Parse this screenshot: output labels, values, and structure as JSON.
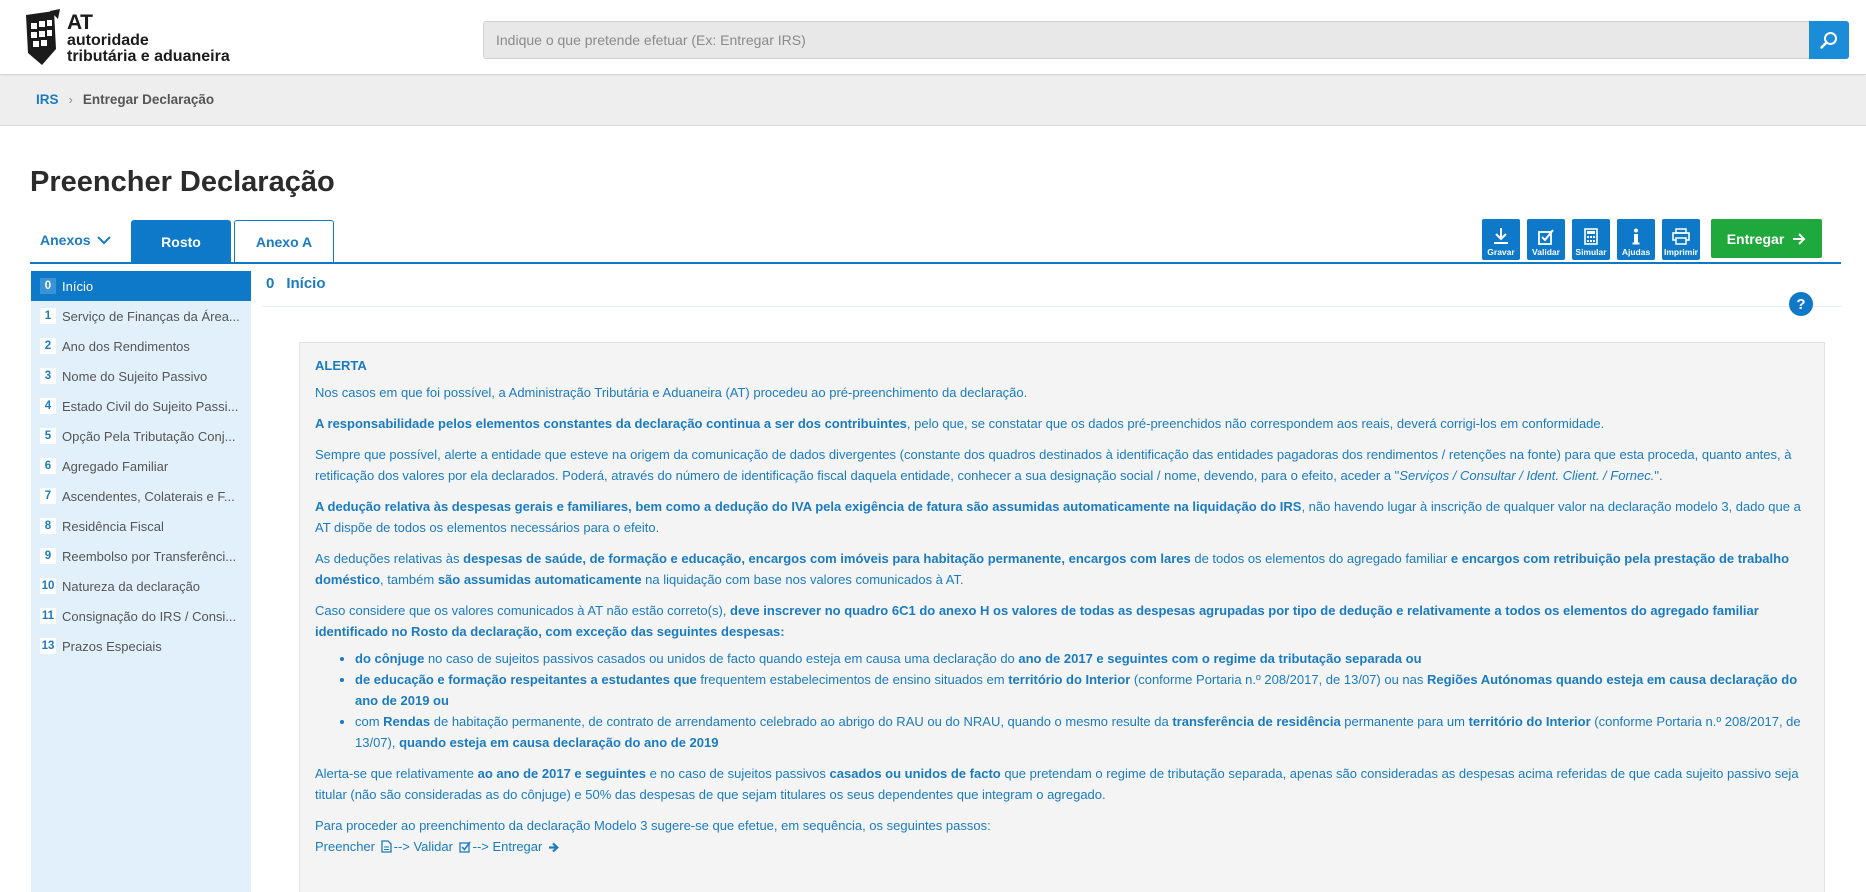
{
  "header": {
    "logo_big": "AT",
    "logo_line1": "autoridade",
    "logo_line2": "tributária e aduaneira",
    "search_placeholder": "Indique o que pretende efetuar (Ex: Entregar IRS)",
    "search_icon": "search-icon",
    "accent_color": "#0e78c9"
  },
  "breadcrumb": {
    "root": "IRS",
    "separator": ">",
    "current": "Entregar Declaração"
  },
  "page_title": "Preencher Declaração",
  "tabs": {
    "anexos_label": "Anexos",
    "rosto_label": "Rosto",
    "anexo_a_label": "Anexo A"
  },
  "toolbar": {
    "gravar": "Gravar",
    "validar": "Validar",
    "simular": "Simular",
    "ajudas": "Ajudas",
    "imprimir": "Imprimir",
    "entregar": "Entregar",
    "entregar_color": "#1fa83c"
  },
  "sidebar": {
    "items": [
      {
        "num": "0",
        "label": "Início"
      },
      {
        "num": "1",
        "label": "Serviço de Finanças da Área..."
      },
      {
        "num": "2",
        "label": "Ano dos Rendimentos"
      },
      {
        "num": "3",
        "label": "Nome do Sujeito Passivo"
      },
      {
        "num": "4",
        "label": "Estado Civil do Sujeito Passi..."
      },
      {
        "num": "5",
        "label": "Opção Pela Tributação Conj..."
      },
      {
        "num": "6",
        "label": "Agregado Familiar"
      },
      {
        "num": "7",
        "label": "Ascendentes, Colaterais e F..."
      },
      {
        "num": "8",
        "label": "Residência Fiscal"
      },
      {
        "num": "9",
        "label": "Reembolso por Transferênci..."
      },
      {
        "num": "10",
        "label": "Natureza da declaração"
      },
      {
        "num": "11",
        "label": "Consignação do IRS / Consi..."
      },
      {
        "num": "13",
        "label": "Prazos Especiais"
      }
    ]
  },
  "section": {
    "num": "0",
    "title": "Início",
    "help": "?"
  },
  "alert": {
    "title": "ALERTA",
    "p1": "Nos casos em que foi possível, a Administração Tributária e Aduaneira (AT) procedeu ao pré-preenchimento da declaração.",
    "p2_bold": "A responsabilidade pelos elementos constantes da declaração continua a ser dos contribuintes",
    "p2_rest": ", pelo que, se constatar que os dados pré-preenchidos não correspondem aos reais, deverá corrigi-los em conformidade.",
    "p3_a": "Sempre que possível, alerte a entidade que esteve na origem da comunicação de dados divergentes (constante dos quadros destinados à identificação das entidades pagadoras dos rendimentos / retenções na fonte) para que esta proceda, quanto antes, à retificação dos valores por ela declarados. Poderá, através do número de identificação fiscal daquela entidade, conhecer a sua designação social / nome, devendo, para o efeito, aceder a \"",
    "p3_italic": "Serviços / Consultar / Ident. Client. / Fornec.",
    "p3_end": "\".",
    "p4_bold": "A dedução relativa às despesas gerais e familiares, bem como a dedução do IVA pela exigência de fatura são assumidas automaticamente na liquidação do IRS",
    "p4_rest": ", não havendo lugar à inscrição de qualquer valor na declaração modelo 3, dado que a AT dispõe de todos os elementos necessários para o efeito.",
    "p5_a": "As deduções relativas às ",
    "p5_b1": "despesas de saúde, de formação e educação, encargos com imóveis para habitação permanente, encargos com lares",
    "p5_c": " de todos os elementos do agregado familiar ",
    "p5_b2": "e encargos com retribuição pela prestação de trabalho doméstico",
    "p5_d": ", também ",
    "p5_b3": "são assumidas automaticamente",
    "p5_e": " na liquidação com base nos valores comunicados à AT.",
    "p6_a": "Caso considere que os valores comunicados à AT não estão correto(s), ",
    "p6_b": "deve inscrever no quadro 6C1 do anexo H os valores de todas as despesas agrupadas por tipo de dedução e relativamente a todos os elementos do agregado familiar identificado no Rosto da declaração, com exceção das seguintes despesas:",
    "li1_b1": "do cônjuge",
    "li1_a": " no caso de sujeitos passivos casados ou unidos de facto quando esteja em causa uma declaração do ",
    "li1_b2": "ano de 2017 e seguintes com o regime da tributação separada ou",
    "li2_b1": "de educação e formação respeitantes a estudantes que",
    "li2_a": " frequentem estabelecimentos de ensino situados em ",
    "li2_b2": "território do Interior",
    "li2_c": " (conforme Portaria n.º 208/2017, de 13/07) ou nas ",
    "li2_b3": "Regiões Autónomas quando esteja em causa declaração do ano de 2019 ou",
    "li3_a": "com ",
    "li3_b1": "Rendas",
    "li3_c": " de habitação permanente, de contrato de arrendamento celebrado ao abrigo do RAU ou do NRAU, quando o mesmo resulte da ",
    "li3_b2": "transferência de residência",
    "li3_d": " permanente para um ",
    "li3_b3": "território do Interior",
    "li3_e": " (conforme Portaria n.º 208/2017, de 13/07), ",
    "li3_b4": "quando esteja em causa declaração do ano de 2019",
    "p7_a": "Alerta-se que relativamente ",
    "p7_b1": "ao ano de 2017 e seguintes",
    "p7_c": " e no caso de sujeitos passivos ",
    "p7_b2": "casados ou unidos de facto",
    "p7_d": " que pretendam o regime de tributação separada, apenas são consideradas as despesas acima referidas de que cada sujeito passivo seja titular (não são consideradas as do cônjuge) e 50% das despesas de que sejam titulares os seus dependentes que integram o agregado.",
    "p8": "Para proceder ao preenchimento da declaração Modelo 3 sugere-se que efetue, em sequência, os seguintes passos:",
    "step1": "Preencher",
    "arrow1": "--> Validar",
    "arrow2": "--> Entregar"
  }
}
